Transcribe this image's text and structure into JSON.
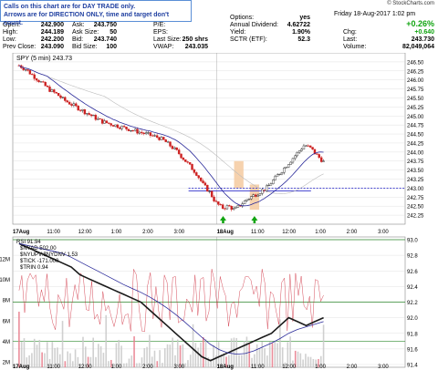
{
  "header": {
    "note_line1": "Calls on this chart are for DAY TRADE only.",
    "note_line2": "Arrows are for DIRECTION ONLY, time and target don't count.",
    "date_time": "Friday 18-Aug-2017 1:02 pm",
    "logo": "© StockCharts.com",
    "open_label": "Open:",
    "open_value": "242.900",
    "high_label": "High:",
    "high_value": "244.189",
    "low_label": "Low:",
    "low_value": "242.200",
    "prevclose_label": "Prev Close:",
    "prevclose_value": "243.090",
    "ask_label": "Ask:",
    "ask_value": "243.750",
    "asksize_label": "Ask Size:",
    "asksize_value": "50",
    "bid_label": "Bid:",
    "bid_value": "243.740",
    "bidsize_label": "Bid Size:",
    "bidsize_value": "100",
    "pe_label": "P/E:",
    "pe_value": "",
    "eps_label": "EPS:",
    "eps_value": "",
    "lastsize_label": "Last Size:",
    "lastsize_value": "250 shrs",
    "vwap_label": "VWAP:",
    "vwap_value": "243.035",
    "options_label": "Options:",
    "options_value": "yes",
    "anndiv_label": "Annual Dividend:",
    "anndiv_value": "4.62722",
    "yield_label": "Yield:",
    "yield_value": "1.90%",
    "sctr_label": "SCTR (ETF):",
    "sctr_value": "52.3",
    "change_pct": "+0.26%",
    "chg_label": "Chg:",
    "chg_value": "+0.640",
    "last_label": "Last:",
    "last_value": "243.730",
    "volume_label": "Volume:",
    "volume_value": "82,049,064"
  },
  "colors": {
    "bull": "#1a1a1a",
    "bear": "#cc2020",
    "ma": "#2a2a9a",
    "ma2": "#bbbbbb",
    "hline": "#3333cc",
    "shade": "#f4c79a",
    "arrow": "#11a411",
    "grid": "#cccccc",
    "rsi": "#cc2233",
    "green_line": "#2f8a2f"
  },
  "chart_data": [
    {
      "type": "candlestick",
      "title": "SPY (5 min) 243.73",
      "ylim": [
        242.0,
        246.75
      ],
      "yticks": [
        "246.50",
        "246.25",
        "246.00",
        "245.75",
        "245.50",
        "245.25",
        "245.00",
        "244.75",
        "244.50",
        "244.25",
        "244.00",
        "243.75",
        "243.50",
        "243.25",
        "243.00",
        "242.75",
        "242.50",
        "242.25"
      ],
      "xticks": [
        "17Aug",
        "11:00",
        "12:00",
        "1:00",
        "2:00",
        "3:00",
        "18Aug",
        "11:00",
        "12:00",
        "1:00",
        "2:00",
        "3:00"
      ],
      "xtick_positions": [
        0,
        1.3,
        2.3,
        3.3,
        4.3,
        5.3,
        6.5,
        7.8,
        8.8,
        9.8,
        10.8,
        11.8
      ],
      "close_path": [
        246.4,
        246.3,
        246.15,
        246.0,
        245.85,
        245.7,
        245.6,
        245.45,
        245.35,
        245.25,
        245.15,
        245.05,
        244.95,
        244.85,
        244.8,
        244.75,
        244.7,
        244.65,
        244.6,
        244.55,
        244.5,
        244.45,
        244.4,
        244.3,
        244.15,
        244.0,
        243.8,
        243.6,
        243.4,
        243.1,
        242.9,
        242.6,
        242.45,
        242.5,
        242.4,
        242.55,
        242.7,
        242.8,
        242.9,
        243.0,
        243.2,
        243.4,
        243.6,
        243.8,
        244.0,
        244.2,
        244.1,
        243.9,
        243.73
      ],
      "vwap_line": 243.0,
      "shaded_boxes": [
        [
          7.05,
          7.35,
          243.0,
          243.75
        ],
        [
          7.55,
          7.85,
          242.4,
          243.1
        ]
      ],
      "arrows_at": [
        6.7,
        7.7
      ]
    },
    {
      "type": "line",
      "title": "RSI 91.94",
      "legend": [
        "$NYAD 502.00",
        "$NYUPV:$NYDNV 1.53",
        "$TICK -171.000",
        "$TRIN 0.94"
      ],
      "left_ticks": [
        "12M",
        "10M",
        "8M",
        "6M",
        "4M",
        "2M"
      ],
      "right_ticks": [
        "93.0",
        "92.8",
        "92.6",
        "92.4",
        "92.2",
        "92.0",
        "91.8",
        "91.6",
        "91.4"
      ],
      "ylim_right": [
        91.4,
        93.0
      ],
      "line_path": [
        92.95,
        92.9,
        92.85,
        92.8,
        92.75,
        92.7,
        92.65,
        92.55,
        92.5,
        92.45,
        92.4,
        92.35,
        92.3,
        92.25,
        92.2,
        92.1,
        92.0,
        91.9,
        91.8,
        91.7,
        91.6,
        91.5,
        91.45,
        91.5,
        91.55,
        91.6,
        91.65,
        91.7,
        91.75,
        91.8,
        91.9,
        92.0,
        91.95,
        91.9,
        91.95,
        92.0
      ],
      "green_levels": [
        92.2,
        91.7,
        93.0
      ]
    }
  ]
}
